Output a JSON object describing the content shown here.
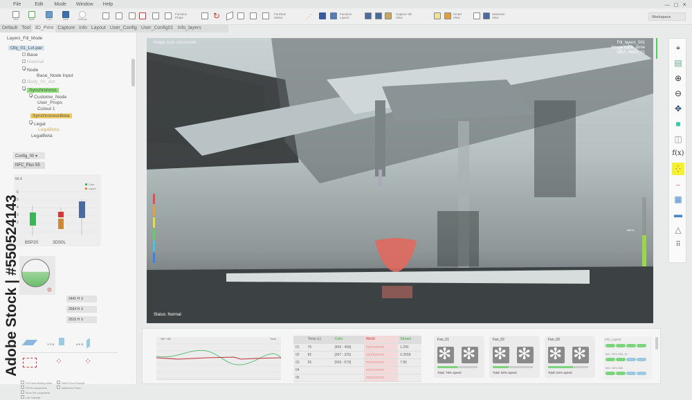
{
  "menu": [
    "File",
    "Edit",
    "Mode",
    "Window",
    "Help"
  ],
  "toolbar": {
    "file_buttons": [
      "New",
      "Open",
      "Print",
      "Save",
      "Settings"
    ],
    "function_props": "Function Props",
    "function_select": "Function Select",
    "function_layers": "Function Layers",
    "capture_3d": "Capture 3D View",
    "smart_view": "Smart View",
    "selection_view": "Selection View",
    "workspace": "Workspace"
  },
  "tabs": [
    "Default",
    "Tool",
    "3D_Print",
    "Capture",
    "Info",
    "Layout",
    "User_Config",
    "User_Config01",
    "Info_layers"
  ],
  "left": {
    "title": "Layers_Fill_Mode",
    "tree": [
      "Obj_01_Lvl.par",
      "Base",
      "Material",
      "Node",
      "Base_Node Input",
      "Body_01_Act",
      "Synchronous",
      "Custome_Node",
      "User_Props",
      "Cutout 1",
      "SynchronousBeta",
      "Legal",
      "LegalBeta",
      "LegalBeta"
    ],
    "config_select": "Config_00",
    "nfc_button": "NFC_Plus 55",
    "boxplot": {
      "top_label": "56.4",
      "yticks": [
        "6",
        "5",
        "4",
        "3",
        "2"
      ],
      "categories": [
        "B5P20",
        "3D50L"
      ],
      "legend": [
        "Color",
        "Layers"
      ],
      "colors": [
        "#3db35a",
        "#d98a3a",
        "#d23a3a",
        "#4a6aa0"
      ]
    },
    "selects": [
      "2441 H",
      "2594 H",
      "2515 H"
    ],
    "view_labels": [
      "Y F G",
      "X F G"
    ],
    "checkboxes": [
      "Fill Frame Already active",
      "Fill Pre components",
      "Show Pre components",
      "Live Calendar",
      "Select From Example",
      "Addendum Frame"
    ]
  },
  "viewport": {
    "header": "Image scan 1920x1080",
    "info": [
      "Fill_layers_001",
      "Image trace_done",
      "OBJ - heart_01"
    ],
    "status": "Status: Normal",
    "level_label": "688.01"
  },
  "right_tools": [
    "crosshair-icon",
    "layers-panel-icon",
    "zoom-in-icon",
    "zoom-out-icon",
    "move-icon",
    "cube-icon",
    "wireframe-icon",
    "function-icon",
    "points-icon",
    "ruler-icon",
    "grid-icon",
    "panel-icon",
    "cone-icon",
    "dots-icon"
  ],
  "right_tools_fx": "f(x)",
  "line_chart": {
    "title": "356 * 180",
    "label": "Trend",
    "yticks": [
      "100",
      "80",
      "60",
      "40",
      "20",
      "0"
    ]
  },
  "table": {
    "headers": [
      "",
      "Temp (c)",
      "Color",
      "World",
      "Stream"
    ],
    "rows": [
      [
        "01",
        "76",
        "[456 : 468]",
        "mm/mmmm",
        "1.256"
      ],
      [
        "02",
        "82",
        "[307 : 325]",
        "mm/mmmm",
        "0.2658"
      ],
      [
        "03",
        "56",
        "[569 : 679]",
        "mm/mmmm",
        "7.95"
      ],
      [
        "04",
        "",
        "",
        "mm/mmmm",
        ""
      ],
      [
        "05",
        "",
        "",
        "mm/mmmm",
        ""
      ]
    ]
  },
  "fans": [
    {
      "name": "Fan_01",
      "total": "Total: 78% speed",
      "speed": 0.5
    },
    {
      "name": "Fan_02",
      "total": "Total: 50% speed",
      "speed": 0.4
    },
    {
      "name": "Fan_03",
      "total": "Total: 54% speed",
      "speed": 0.62
    }
  ],
  "info_layers": {
    "title": "Info_Layers",
    "lines": [
      "info: 29% G80_01",
      "info: 48% G80"
    ]
  },
  "watermark": "Adobe Stock | #550524143"
}
